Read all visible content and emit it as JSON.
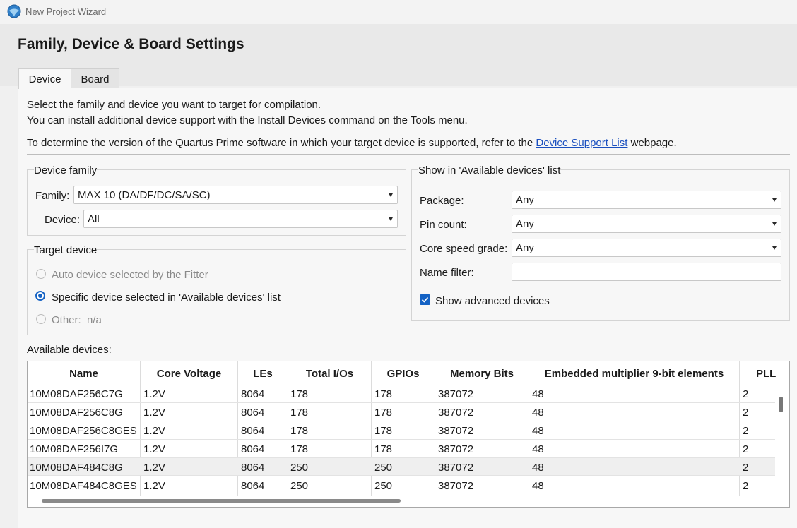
{
  "window": {
    "title": "New Project Wizard"
  },
  "header": {
    "title": "Family, Device & Board Settings"
  },
  "tabs": [
    {
      "label": "Device"
    },
    {
      "label": "Board"
    }
  ],
  "intro": {
    "line1": "Select the family and device you want to target for compilation.",
    "line2": "You can install additional device support with the Install Devices command on the Tools menu.",
    "line3_prefix": "To determine the version of the Quartus Prime software in which your target device is supported, refer to the",
    "line3_link": "Device Support List",
    "line3_suffix": "webpage."
  },
  "device_family": {
    "legend": "Device family",
    "family_label": "Family:",
    "family_value": "MAX 10 (DA/DF/DC/SA/SC)",
    "device_label": "Device:",
    "device_value": "All"
  },
  "target_device": {
    "legend": "Target device",
    "options": [
      {
        "label": "Auto device selected by the Fitter",
        "checked": false,
        "enabled": false
      },
      {
        "label": "Specific device selected in 'Available devices' list",
        "checked": true,
        "enabled": true
      },
      {
        "label": "Other:",
        "value": "n/a",
        "checked": false,
        "enabled": false
      }
    ]
  },
  "show_filters": {
    "legend": "Show in 'Available devices' list",
    "package_label": "Package:",
    "package_value": "Any",
    "pincount_label": "Pin count:",
    "pincount_value": "Any",
    "speed_label": "Core speed grade:",
    "speed_value": "Any",
    "name_filter_label": "Name filter:",
    "name_filter_value": "",
    "show_advanced_label": "Show advanced devices",
    "show_advanced_checked": true
  },
  "available_devices": {
    "label": "Available devices:",
    "columns": [
      "Name",
      "Core Voltage",
      "LEs",
      "Total I/Os",
      "GPIOs",
      "Memory Bits",
      "Embedded multiplier 9-bit elements",
      "PLL"
    ],
    "rows": [
      [
        "10M08DAF256C7G",
        "1.2V",
        "8064",
        "178",
        "178",
        "387072",
        "48",
        "2"
      ],
      [
        "10M08DAF256C8G",
        "1.2V",
        "8064",
        "178",
        "178",
        "387072",
        "48",
        "2"
      ],
      [
        "10M08DAF256C8GES",
        "1.2V",
        "8064",
        "178",
        "178",
        "387072",
        "48",
        "2"
      ],
      [
        "10M08DAF256I7G",
        "1.2V",
        "8064",
        "178",
        "178",
        "387072",
        "48",
        "2"
      ],
      [
        "10M08DAF484C8G",
        "1.2V",
        "8064",
        "250",
        "250",
        "387072",
        "48",
        "2"
      ],
      [
        "10M08DAF484C8GES",
        "1.2V",
        "8064",
        "250",
        "250",
        "387072",
        "48",
        "2"
      ]
    ],
    "highlighted_row": 4
  },
  "colors": {
    "accent": "#1462c4",
    "link": "#1a4fbf"
  }
}
